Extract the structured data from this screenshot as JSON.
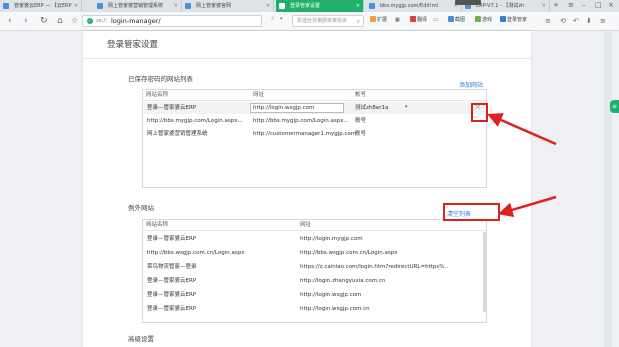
{
  "tabs": [
    {
      "label": "管家婆云ERP — 【云ERP",
      "active": false
    },
    {
      "label": "网上管家婆营销管理系统",
      "active": false
    },
    {
      "label": "网上管家婆官网",
      "active": false
    },
    {
      "label": "登录管家设置",
      "active": true
    },
    {
      "label": "bbs.mygjp.com/Edit!ml",
      "active": false
    },
    {
      "label": "ERP-V7.1 - 【测试zh",
      "active": false
    }
  ],
  "toolbar": {
    "url_scheme": "se://",
    "url_path": "login-manager/",
    "search_placeholder": "凯迪丝苏格颁奖被追杀",
    "items": [
      {
        "label": "扩展",
        "color": "#e8a23a"
      },
      {
        "label": "翻译",
        "color": "#d94141"
      },
      {
        "label": "截图",
        "color": "#4a90d9"
      },
      {
        "label": "游戏",
        "color": "#6bb34a"
      },
      {
        "label": "登录管家",
        "color": "#3a7bd5"
      }
    ]
  },
  "page": {
    "title": "登录管家设置",
    "saved_section": {
      "title": "已保存密码的网站列表",
      "add_link": "添加网站",
      "headers": [
        "网站名称",
        "网址",
        "帐号"
      ],
      "rows": [
        {
          "name": "登录—管家婆云ERP",
          "url": "http://login.wsgjp.com",
          "account": "测试zh8er1a"
        },
        {
          "name": "http://bbs.mygjp.com/Login.aspx...",
          "url": "http://bbs.mygjp.com/Login.aspx...",
          "account": "账号"
        },
        {
          "name": "网上管家婆营销管理系统",
          "url": "http://customermanager1.mygjp.com",
          "account": "账号"
        }
      ]
    },
    "exception_section": {
      "title": "例外网站",
      "clear_link": "清空列表",
      "headers": [
        "网站名称",
        "网址"
      ],
      "rows": [
        {
          "name": "登录—管家婆云ERP",
          "url": "http://login.mygjp.com"
        },
        {
          "name": "http://bbs.wsgjp.com.cn/Login.aspx",
          "url": "http://bbs.wsgjp.com.cn/Login.aspx"
        },
        {
          "name": "菜鸟物流管家—登录",
          "url": "https://z.cainiao.com/login.htm?redirectURL=https%..."
        },
        {
          "name": "登录—管家婆云ERP",
          "url": "http://login.zhangyuxia.com.cn"
        },
        {
          "name": "登录—管家婆云ERP",
          "url": "http://login.wsgjp.com"
        },
        {
          "name": "登录—管家婆云ERP",
          "url": "http://login.wsgjp.com.cn"
        }
      ]
    },
    "advanced_title": "高级设置"
  },
  "colors": {
    "accent_green": "#1fb16b",
    "link_blue": "#2a7ae2",
    "annotation_red": "#e02020"
  }
}
